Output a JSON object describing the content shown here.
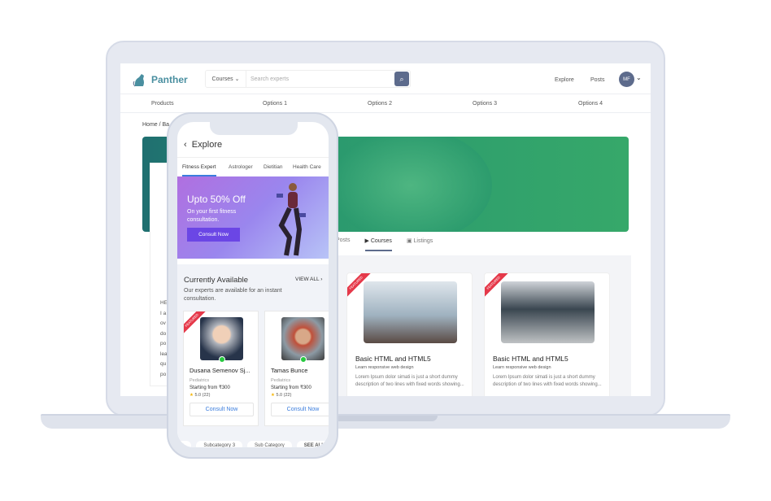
{
  "laptop": {
    "brand": "Panther",
    "search": {
      "category": "Courses",
      "placeholder": "Search experts"
    },
    "nav": [
      "Explore",
      "Posts"
    ],
    "avatar_initials": "MF",
    "menu": [
      "Products",
      "Options 1",
      "Options 2",
      "Options 3",
      "Options 4"
    ],
    "breadcrumb": "Home / Ba",
    "side_text": [
      "HE",
      "I a",
      "ov",
      "do",
      "po",
      "lea",
      "qu",
      "po"
    ],
    "tabs": [
      "Posts",
      "Courses",
      "Listings"
    ],
    "active_tab": "Courses",
    "courses": [
      {
        "badge": "FEATURED",
        "title": "Basic HTML and HTML5",
        "subtitle": "Learn responsive web design",
        "desc": "Lorem Ipsum dolor simati is just a short dummy description of two lines with fixed words showing..."
      },
      {
        "badge": "FEATURED",
        "title": "Basic HTML and HTML5",
        "subtitle": "Learn responsive web design",
        "desc": "Lorem Ipsum dolor simati is just a short dummy description of two lines with fixed words showing..."
      }
    ]
  },
  "phone": {
    "title": "Explore",
    "tabs": [
      "Fitness Expert",
      "Astrologer",
      "Dietitian",
      "Health Care"
    ],
    "active_tab": "Fitness Expert",
    "banner": {
      "headline": "Upto 50% Off",
      "sub": "On your first fitness consultation.",
      "cta": "Consult Now"
    },
    "section": {
      "title": "Currently Available",
      "view_all": "VIEW ALL",
      "sub": "Our experts are available for an instant consultation."
    },
    "experts": [
      {
        "badge": "FEATURED",
        "name": "Dusana Semenov  Sj...",
        "specialty": "Pediatrics",
        "price": "Starting from ₹300",
        "rating": "5.0 (22)",
        "cta": "Consult Now"
      },
      {
        "name": "Tamas Bunce",
        "specialty": "Pediatrics",
        "price": "Starting from ₹300",
        "rating": "5.0 (22)",
        "cta": "Consult Now"
      }
    ],
    "chips": [
      "ass",
      "Subcategory 3",
      "Sub Category",
      "SEE ALL"
    ]
  },
  "colors": {
    "accent": "#5d6b8c",
    "brand": "#4a8fa0",
    "cta": "#6b46e5",
    "link": "#3b7ddd",
    "featured": "#e5394a",
    "online": "#27c93f"
  }
}
